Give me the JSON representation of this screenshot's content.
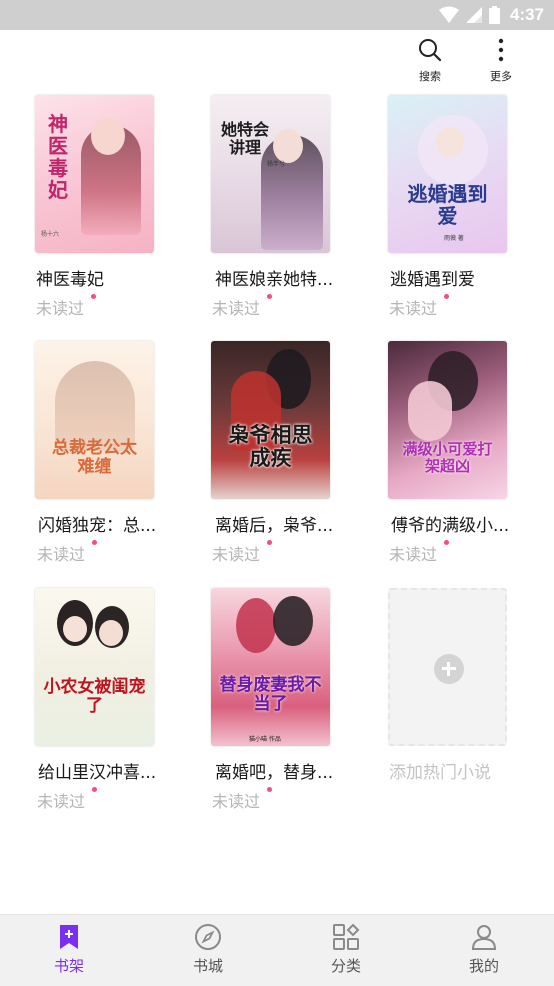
{
  "status_bar": {
    "time": "4:37"
  },
  "top_actions": {
    "search_label": "搜索",
    "more_label": "更多"
  },
  "books": [
    {
      "title": "神医毒妃",
      "status": "未读过",
      "cover_title": "神医毒妃",
      "cover_author": "杨十六"
    },
    {
      "title": "神医娘亲她特...",
      "status": "未读过",
      "cover_title": "她特会讲理",
      "cover_author": "杨芊兮"
    },
    {
      "title": "逃婚遇到爱",
      "status": "未读过",
      "cover_title": "逃婚遇到爱",
      "cover_author": "雨薇 著"
    },
    {
      "title": "闪婚独宠：总...",
      "status": "未读过",
      "cover_title": "总裁老公太难缠",
      "cover_author": ""
    },
    {
      "title": "离婚后，枭爷...",
      "status": "未读过",
      "cover_title": "枭爷相思成疾",
      "cover_author": ""
    },
    {
      "title": "傅爷的满级小...",
      "status": "未读过",
      "cover_title": "满级小可爱打架超凶",
      "cover_author": ""
    },
    {
      "title": "给山里汉冲喜...",
      "status": "未读过",
      "cover_title": "小农女被闺宠了",
      "cover_author": ""
    },
    {
      "title": "离婚吧，替身...",
      "status": "未读过",
      "cover_title": "替身废妻我不当了",
      "cover_author": "猫小喵 作品"
    }
  ],
  "add_book": {
    "label": "添加热门小说"
  },
  "bottom_nav": [
    {
      "label": "书架",
      "icon": "bookmark-icon",
      "active": true
    },
    {
      "label": "书城",
      "icon": "compass-icon",
      "active": false
    },
    {
      "label": "分类",
      "icon": "grid-icon",
      "active": false
    },
    {
      "label": "我的",
      "icon": "person-icon",
      "active": false
    }
  ],
  "colors": {
    "accent": "#7b2ff0",
    "unread_dot": "#f24e7f",
    "status_bar": "#cfcfcf"
  }
}
